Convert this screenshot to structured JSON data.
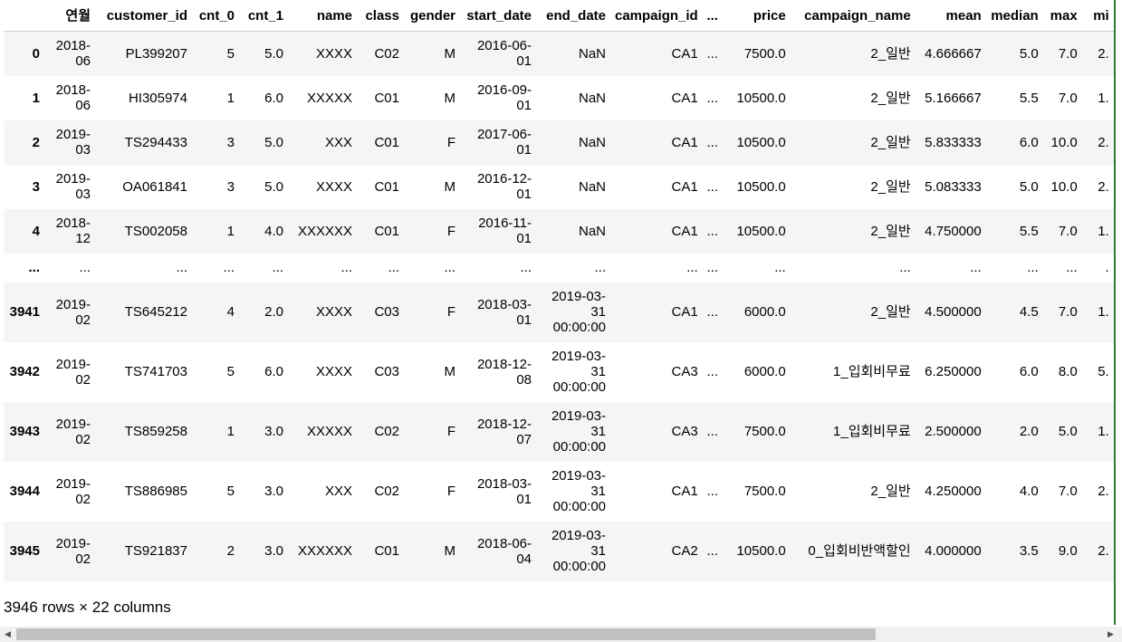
{
  "table": {
    "columns": [
      "",
      "연월",
      "customer_id",
      "cnt_0",
      "cnt_1",
      "name",
      "class",
      "gender",
      "start_date",
      "end_date",
      "campaign_id",
      "...",
      "price",
      "campaign_name",
      "mean",
      "median",
      "max",
      "mi"
    ],
    "rows": [
      [
        "0",
        "2018-06",
        "PL399207",
        "5",
        "5.0",
        "XXXX",
        "C02",
        "M",
        "2016-06-01",
        "NaN",
        "CA1",
        "...",
        "7500.0",
        "2_일반",
        "4.666667",
        "5.0",
        "7.0",
        "2."
      ],
      [
        "1",
        "2018-06",
        "HI305974",
        "1",
        "6.0",
        "XXXXX",
        "C01",
        "M",
        "2016-09-01",
        "NaN",
        "CA1",
        "...",
        "10500.0",
        "2_일반",
        "5.166667",
        "5.5",
        "7.0",
        "1."
      ],
      [
        "2",
        "2019-03",
        "TS294433",
        "3",
        "5.0",
        "XXX",
        "C01",
        "F",
        "2017-06-01",
        "NaN",
        "CA1",
        "...",
        "10500.0",
        "2_일반",
        "5.833333",
        "6.0",
        "10.0",
        "2."
      ],
      [
        "3",
        "2019-03",
        "OA061841",
        "3",
        "5.0",
        "XXXX",
        "C01",
        "M",
        "2016-12-01",
        "NaN",
        "CA1",
        "...",
        "10500.0",
        "2_일반",
        "5.083333",
        "5.0",
        "10.0",
        "2."
      ],
      [
        "4",
        "2018-12",
        "TS002058",
        "1",
        "4.0",
        "XXXXXX",
        "C01",
        "F",
        "2016-11-01",
        "NaN",
        "CA1",
        "...",
        "10500.0",
        "2_일반",
        "4.750000",
        "5.5",
        "7.0",
        "1."
      ],
      [
        "...",
        "...",
        "...",
        "...",
        "...",
        "...",
        "...",
        "...",
        "...",
        "...",
        "...",
        "...",
        "...",
        "...",
        "...",
        "...",
        "...",
        "."
      ],
      [
        "3941",
        "2019-02",
        "TS645212",
        "4",
        "2.0",
        "XXXX",
        "C03",
        "F",
        "2018-03-01",
        "2019-03-31 00:00:00",
        "CA1",
        "...",
        "6000.0",
        "2_일반",
        "4.500000",
        "4.5",
        "7.0",
        "1."
      ],
      [
        "3942",
        "2019-02",
        "TS741703",
        "5",
        "6.0",
        "XXXX",
        "C03",
        "M",
        "2018-12-08",
        "2019-03-31 00:00:00",
        "CA3",
        "...",
        "6000.0",
        "1_입회비무료",
        "6.250000",
        "6.0",
        "8.0",
        "5."
      ],
      [
        "3943",
        "2019-02",
        "TS859258",
        "1",
        "3.0",
        "XXXXX",
        "C02",
        "F",
        "2018-12-07",
        "2019-03-31 00:00:00",
        "CA3",
        "...",
        "7500.0",
        "1_입회비무료",
        "2.500000",
        "2.0",
        "5.0",
        "1."
      ],
      [
        "3944",
        "2019-02",
        "TS886985",
        "5",
        "3.0",
        "XXX",
        "C02",
        "F",
        "2018-03-01",
        "2019-03-31 00:00:00",
        "CA1",
        "...",
        "7500.0",
        "2_일반",
        "4.250000",
        "4.0",
        "7.0",
        "2."
      ],
      [
        "3945",
        "2019-02",
        "TS921837",
        "2",
        "3.0",
        "XXXXXX",
        "C01",
        "M",
        "2018-06-04",
        "2019-03-31 00:00:00",
        "CA2",
        "...",
        "10500.0",
        "0_입회비반액할인",
        "4.000000",
        "3.5",
        "9.0",
        "2."
      ]
    ]
  },
  "summary": "3946 rows × 22 columns",
  "scrollbar": {
    "left_icon": "left-arrow-icon",
    "right_icon": "right-arrow-icon"
  }
}
